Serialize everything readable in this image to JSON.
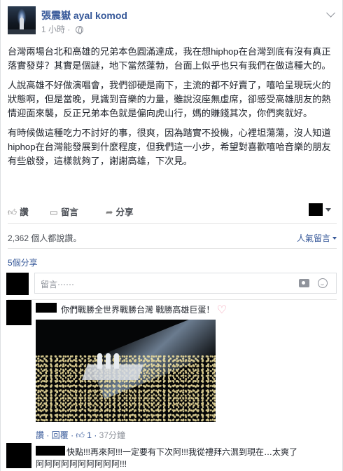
{
  "post": {
    "author": "張震嶽 ayal komod",
    "time": "1 小時",
    "paragraphs": [
      "台灣兩場台北和高雄的兄弟本色圓滿達成，我在想hiphop在台灣到底有沒有真正落實發芽？其實是個謎，地下當然蓬勃，台面上似乎也只有我們在做這種大的。",
      "人說高雄不好做演唱會，我們卻硬是南下，主流的都不好賣了，嘻哈呈現玩火的狀態啊，但是當晚，見識到音樂的力量，雖說沒座無虛席，卻感受高雄朋友的熱情迎面來襲，反正兄弟本色就是偏向虎山行，媽的賺錢其次，你們爽就好。",
      "有時候做這種吃力不討好的事，很爽，因為踏實不投機，心裡坦蕩蕩，沒人知道hiphop在台灣能發展到什麼程度，但我們這一小步，希望對喜歡嘻哈音樂的朋友有些啟發，這樣就夠了，謝謝高雄，下次見。"
    ],
    "actions": {
      "like": "讚",
      "comment": "留言",
      "share": "分享"
    },
    "likes_text": "2,362 個人都說讚。",
    "sort_label": "人氣留言",
    "shares_text": "5個分享",
    "composer_placeholder": "留言⋯⋯"
  },
  "comments": [
    {
      "text": "你們戰勝全世界戰勝台灣 戰勝高雄巨蛋！",
      "reply_actions": {
        "like": "讚",
        "reply": "回覆",
        "like_count": "1",
        "time": "37分鐘"
      }
    },
    {
      "text_line1": "快點!!!再來阿!!!一定要有下次阿!!!我從禮拜六濕到現在…太爽了",
      "text_line2": "阿阿阿阿阿阿阿阿阿阿!!!"
    }
  ],
  "icons": {
    "globe": "globe-icon",
    "like": "thumbs-up-icon",
    "comment": "speech-bubble-icon",
    "share": "share-arrow-icon",
    "camera": "camera-icon",
    "smile": "emoji-icon",
    "heart": "heart-icon"
  },
  "colors": {
    "link": "#365899",
    "meta": "#90949c",
    "text": "#1d2129",
    "heart": "#f29bb1"
  }
}
